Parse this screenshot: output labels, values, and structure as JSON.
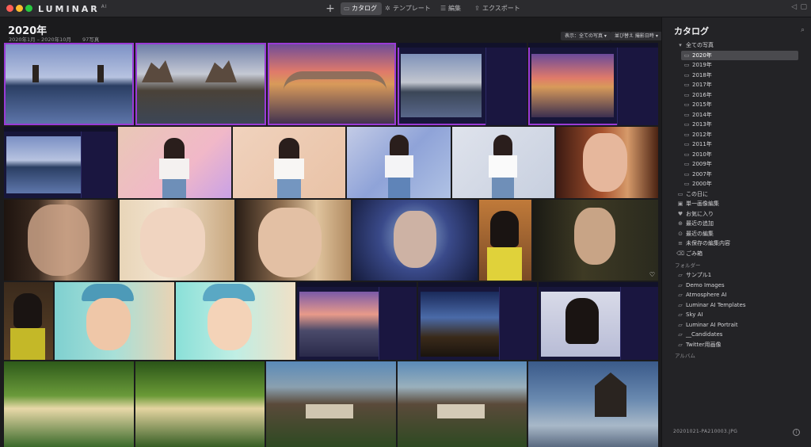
{
  "app": {
    "brand": "LUMINAR",
    "brand_sup": "AI",
    "add_glyph": "+"
  },
  "nav": {
    "tabs": [
      {
        "label": "カタログ",
        "icon": "catalog-icon",
        "active": true
      },
      {
        "label": "テンプレート",
        "icon": "templates-icon",
        "active": false
      },
      {
        "label": "編集",
        "icon": "edit-icon",
        "active": false
      },
      {
        "label": "エクスポート",
        "icon": "export-icon",
        "active": false
      }
    ]
  },
  "header": {
    "title": "2020年",
    "date_range": "2020年1月 – 2020年10月",
    "photo_count": "97写真",
    "show_filter": "表示：全ての写真",
    "sort": "並び替え 撮影日時"
  },
  "sidebar": {
    "title": "カタログ",
    "all_photos": "全ての写真",
    "years": [
      "2020年",
      "2019年",
      "2018年",
      "2017年",
      "2016年",
      "2015年",
      "2014年",
      "2013年",
      "2012年",
      "2011年",
      "2010年",
      "2009年",
      "2007年",
      "2000年"
    ],
    "selected_year": "2020年",
    "shortcuts": [
      {
        "label": "この日に",
        "icon": "calendar-icon"
      },
      {
        "label": "単一画像編集",
        "icon": "single-image-icon"
      },
      {
        "label": "お気に入り",
        "icon": "heart-icon"
      },
      {
        "label": "最近の追加",
        "icon": "recent-add-icon"
      },
      {
        "label": "最近の編集",
        "icon": "recent-edit-icon"
      },
      {
        "label": "未保存の編集内容",
        "icon": "unsaved-icon"
      },
      {
        "label": "ごみ箱",
        "icon": "trash-icon"
      }
    ],
    "folders_label": "フォルダー",
    "folders": [
      "サンプル1",
      "Demo Images",
      "Atmosphere AI",
      "Luminar AI Templates",
      "Sky AI",
      "Luminar AI Portrait",
      "__Candidates",
      "Twitter用画像"
    ],
    "albums_label": "アルバム",
    "filename": "20201021-PA210003.JPG"
  },
  "colors": {
    "selection": "#9a3bd6",
    "accent_row": "#4a4a4e"
  }
}
